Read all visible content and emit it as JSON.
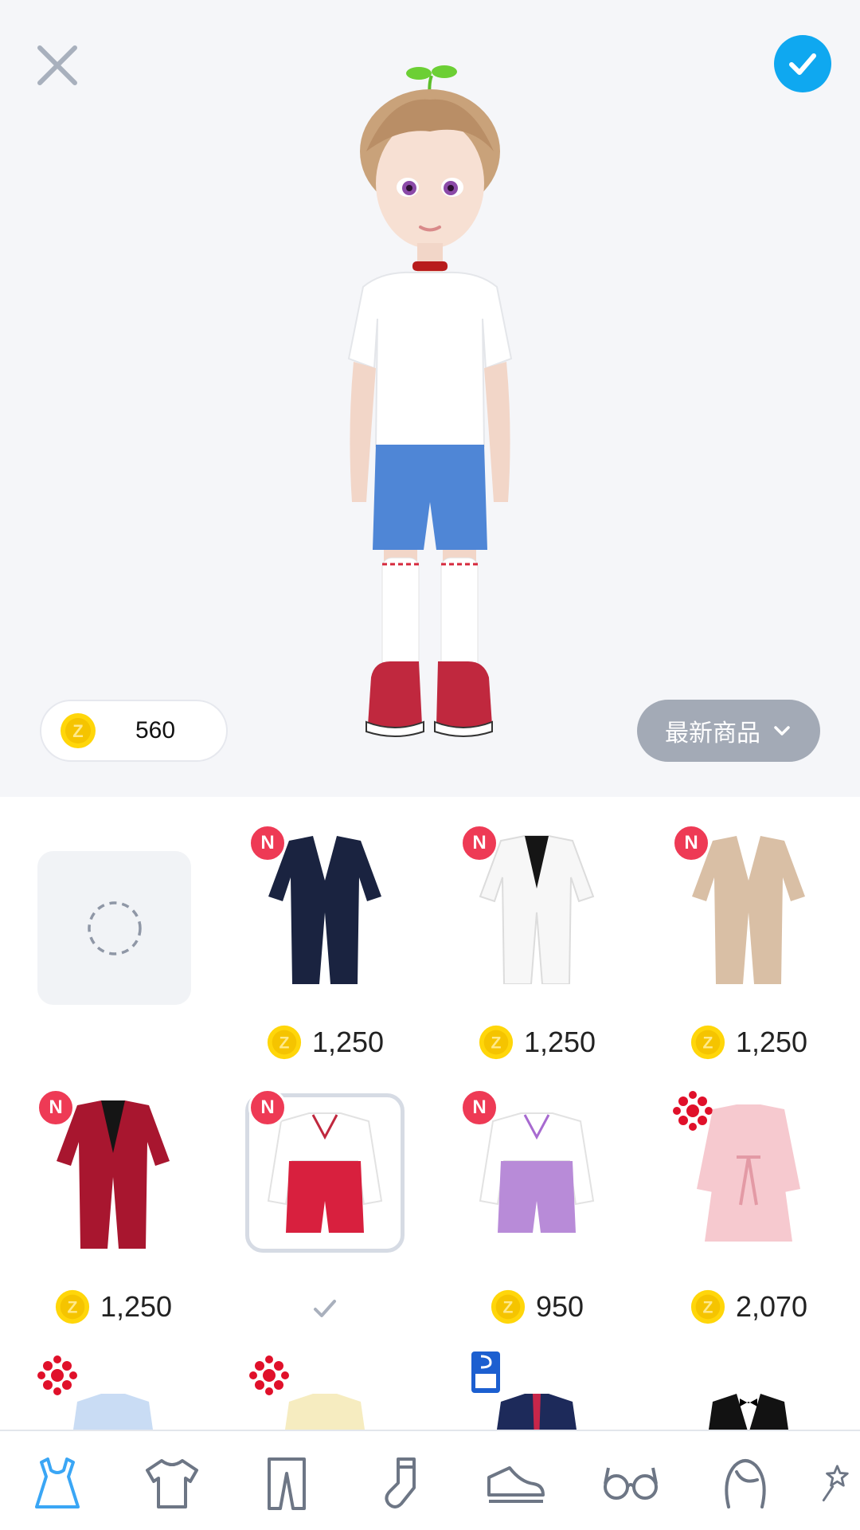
{
  "header": {
    "close_icon": "close-icon",
    "confirm_icon": "check-icon"
  },
  "wallet": {
    "balance": "560",
    "coin_icon": "zepeto-coin-icon",
    "coin_color": "#ffd60a"
  },
  "sort": {
    "label": "最新商品",
    "icon": "chevron-down-icon"
  },
  "items": [
    {
      "id": "empty",
      "price": "",
      "badge": ""
    },
    {
      "name": "navy-suit",
      "price": "1,250",
      "badge": "N"
    },
    {
      "name": "white-suit",
      "price": "1,250",
      "badge": "N"
    },
    {
      "name": "beige-suit",
      "price": "1,250",
      "badge": "N"
    },
    {
      "name": "crimson-suit",
      "price": "1,250",
      "badge": "N"
    },
    {
      "name": "red-shorts-outfit",
      "price": "",
      "badge": "N",
      "selected": true
    },
    {
      "name": "purple-shorts-outfit",
      "price": "950",
      "badge": "N"
    },
    {
      "name": "pink-dress",
      "price": "2,070",
      "badge": "knot"
    },
    {
      "name": "light-blue-outfit",
      "price": "",
      "badge": "knot"
    },
    {
      "name": "yellow-outfit",
      "price": "",
      "badge": "knot"
    },
    {
      "name": "school-uniform",
      "price": "",
      "badge": "pass"
    },
    {
      "name": "tuxedo",
      "price": "",
      "badge": ""
    }
  ],
  "colors": {
    "accent": "#0fa8f0",
    "new_badge": "#ee3a55",
    "nav_active": "#3aa6f5",
    "nav_inactive": "#6d7685"
  },
  "nav": [
    {
      "icon": "dress-icon",
      "active": true
    },
    {
      "icon": "tshirt-icon",
      "active": false
    },
    {
      "icon": "pants-icon",
      "active": false
    },
    {
      "icon": "sock-icon",
      "active": false
    },
    {
      "icon": "sneaker-icon",
      "active": false
    },
    {
      "icon": "glasses-icon",
      "active": false
    },
    {
      "icon": "hair-icon",
      "active": false
    },
    {
      "icon": "star-wand-icon",
      "active": false
    }
  ]
}
